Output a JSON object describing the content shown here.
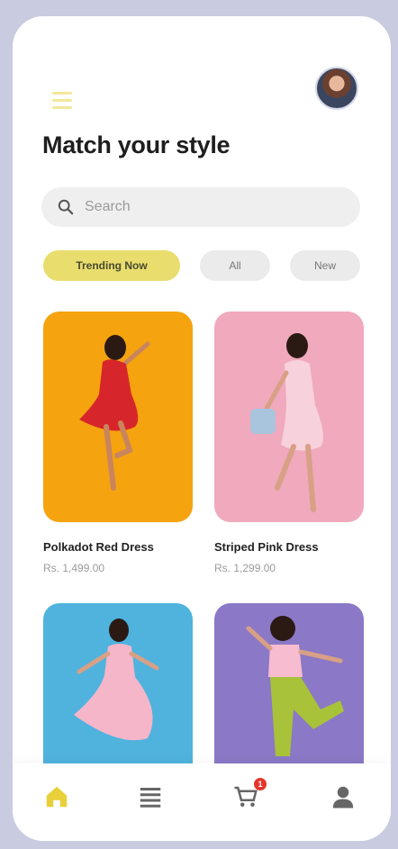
{
  "header": {
    "title_main": "Match your ",
    "title_highlight": "style"
  },
  "search": {
    "placeholder": "Search"
  },
  "filters": [
    {
      "label": "Trending Now",
      "active": true
    },
    {
      "label": "All",
      "active": false
    },
    {
      "label": "New",
      "active": false
    }
  ],
  "products": [
    {
      "name": "Polkadot Red Dress",
      "price": "Rs. 1,499.00",
      "bg": "#f5a30f"
    },
    {
      "name": "Striped Pink Dress",
      "price": "Rs. 1,299.00",
      "bg": "#f0a9bd"
    },
    {
      "bg": "#4fb3de"
    },
    {
      "bg": "#8b78c6"
    }
  ],
  "bottom_nav": [
    {
      "icon": "home-icon",
      "active": true
    },
    {
      "icon": "list-icon",
      "active": false
    },
    {
      "icon": "cart-icon",
      "active": false,
      "badge": "1"
    },
    {
      "icon": "profile-icon",
      "active": false
    }
  ],
  "colors": {
    "accent": "#e9dd6d",
    "badge": "#e5352a"
  }
}
